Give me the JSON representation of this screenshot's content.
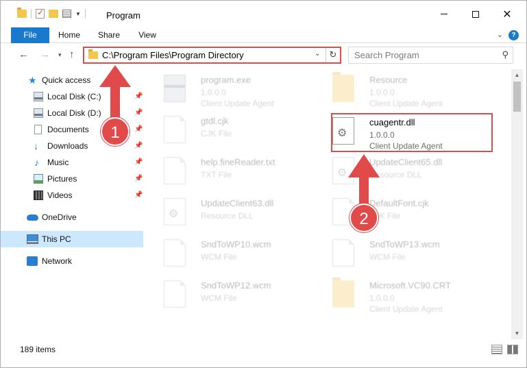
{
  "window": {
    "title": "Program",
    "minimize_icon": "minimize-icon",
    "maximize_icon": "maximize-icon",
    "close_glyph": "✕"
  },
  "ribbon": {
    "tabs": [
      "File",
      "Home",
      "Share",
      "View"
    ],
    "active_tab_color": "#1979ca"
  },
  "nav": {
    "back": "←",
    "forward": "→",
    "recent": "▾",
    "up": "↑"
  },
  "address": {
    "path": "C:\\Program Files\\Program Directory",
    "dropdown": "⌄",
    "refresh": "↻"
  },
  "search": {
    "placeholder": "Search Program",
    "icon_glyph": "⚲"
  },
  "sidebar": {
    "items": [
      {
        "label": "Quick access",
        "icon": "star-icon"
      },
      {
        "label": "Local Disk (C:)",
        "icon": "disk-icon",
        "pinned": true
      },
      {
        "label": "Local Disk (D:)",
        "icon": "disk-icon",
        "pinned": true
      },
      {
        "label": "Documents",
        "icon": "documents-icon",
        "pinned": true
      },
      {
        "label": "Downloads",
        "icon": "download-icon",
        "pinned": true
      },
      {
        "label": "Music",
        "icon": "music-icon",
        "pinned": true
      },
      {
        "label": "Pictures",
        "icon": "pictures-icon",
        "pinned": true
      },
      {
        "label": "Videos",
        "icon": "videos-icon",
        "pinned": true
      },
      {
        "label": "OneDrive",
        "icon": "cloud-icon"
      },
      {
        "label": "This PC",
        "icon": "computer-icon",
        "selected": true
      },
      {
        "label": "Network",
        "icon": "network-icon"
      }
    ],
    "pin_glyph": "📌"
  },
  "files": [
    {
      "name": "program.exe",
      "line1": "1.0.0.0",
      "line2": "Client Update Agent",
      "icon": "exe-icon",
      "faded": true
    },
    {
      "name": "Resource",
      "line1": "1.0.0.0",
      "line2": "Client Update Agent",
      "icon": "folder-icon",
      "faded": true
    },
    {
      "name": "gtdl.cjk",
      "line1": "CJK File",
      "line2": "",
      "icon": "document-icon",
      "faded": true
    },
    {
      "name": "cuagentr.dll",
      "line1": "1.0.0.0",
      "line2": "Client Update Agent",
      "icon": "dll-gear-icon",
      "faded": false,
      "highlighted": true
    },
    {
      "name": "help.fineReader.txt",
      "line1": "TXT File",
      "line2": "",
      "icon": "document-icon",
      "faded": true
    },
    {
      "name": "UpdateClient65.dll",
      "line1": "Resource DLL",
      "line2": "",
      "icon": "dll-gear-icon",
      "faded": true
    },
    {
      "name": "UpdateClient63.dll",
      "line1": "Resource DLL",
      "line2": "",
      "icon": "dll-gear-icon",
      "faded": true
    },
    {
      "name": "DefaultFont.cjk",
      "line1": "CJK File",
      "line2": "",
      "icon": "document-icon",
      "faded": true
    },
    {
      "name": "SndToWP10.wcm",
      "line1": "WCM File",
      "line2": "",
      "icon": "document-icon",
      "faded": true
    },
    {
      "name": "SndToWP13.wcm",
      "line1": "WCM File",
      "line2": "",
      "icon": "document-icon",
      "faded": true
    },
    {
      "name": "SndToWP12.wcm",
      "line1": "WCM File",
      "line2": "",
      "icon": "document-icon",
      "faded": true
    },
    {
      "name": "Microsoft.VC90.CRT",
      "line1": "1.0.0.0",
      "line2": "Client Update Agent",
      "icon": "folder-icon",
      "faded": true
    }
  ],
  "status": {
    "item_count": "189 items"
  },
  "annotations": {
    "badge1": "1",
    "badge2": "2",
    "color": "#e04a4a"
  },
  "scrollbar": {
    "up": "▲",
    "down": "▼"
  }
}
